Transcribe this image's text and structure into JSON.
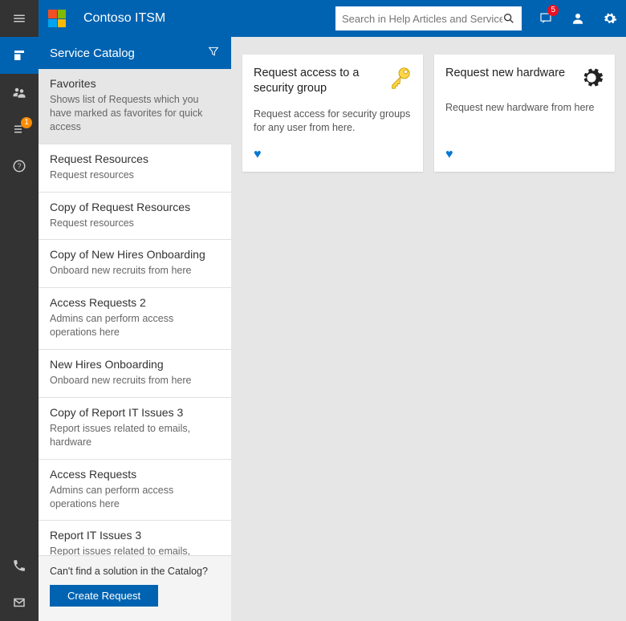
{
  "header": {
    "app_title": "Contoso ITSM",
    "search_placeholder": "Search in Help Articles and Services",
    "notifications_count": "5"
  },
  "rail": {
    "badge_count": "1"
  },
  "sidebar": {
    "title": "Service Catalog",
    "items": [
      {
        "title": "Favorites",
        "desc": "Shows list of Requests which you have marked as favorites for quick access"
      },
      {
        "title": "Request Resources",
        "desc": "Request resources"
      },
      {
        "title": "Copy of Request Resources",
        "desc": "Request resources"
      },
      {
        "title": "Copy of New Hires Onboarding",
        "desc": "Onboard new recruits from here"
      },
      {
        "title": "Access Requests 2",
        "desc": "Admins can perform access operations here"
      },
      {
        "title": "New Hires Onboarding",
        "desc": "Onboard new recruits from here"
      },
      {
        "title": "Copy of Report IT Issues 3",
        "desc": "Report issues related to emails, hardware"
      },
      {
        "title": "Access Requests",
        "desc": "Admins can perform access operations here"
      },
      {
        "title": "Report IT Issues 3",
        "desc": "Report issues related to emails, hardware"
      }
    ],
    "footer_question": "Can't find a solution in the Catalog?",
    "create_label": "Create Request"
  },
  "cards": [
    {
      "title": "Request access to a security group",
      "desc": "Request access for security groups for any user from here.",
      "icon": "key"
    },
    {
      "title": "Request new hardware",
      "desc": "Request new hardware from here",
      "icon": "gear"
    }
  ]
}
